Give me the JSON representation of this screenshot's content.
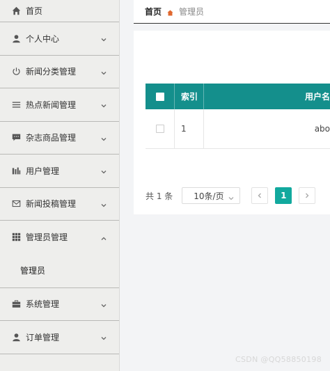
{
  "sidebar": {
    "items": [
      {
        "label": "首页",
        "icon": "home-icon"
      },
      {
        "label": "个人中心",
        "icon": "user-icon"
      },
      {
        "label": "新闻分类管理",
        "icon": "power-icon"
      },
      {
        "label": "热点新闻管理",
        "icon": "list-icon"
      },
      {
        "label": "杂志商品管理",
        "icon": "comment-icon"
      },
      {
        "label": "用户管理",
        "icon": "bars-icon"
      },
      {
        "label": "新闻投稿管理",
        "icon": "mail-icon"
      },
      {
        "label": "管理员管理",
        "icon": "grid-icon",
        "expanded": true,
        "children": [
          {
            "label": "管理员"
          }
        ]
      },
      {
        "label": "系统管理",
        "icon": "briefcase-icon"
      },
      {
        "label": "订单管理",
        "icon": "user-icon"
      }
    ]
  },
  "breadcrumb": {
    "home": "首页",
    "current": "管理员"
  },
  "table": {
    "headers": {
      "index": "索引",
      "username": "用户名"
    },
    "rows": [
      {
        "index": "1",
        "username": "abo"
      }
    ]
  },
  "pagination": {
    "total": "共 1 条",
    "page_size": "10条/页",
    "current_page": "1"
  },
  "watermark": "CSDN @QQ58850198",
  "colors": {
    "accent": "#148f8c",
    "page_active": "#12a99e",
    "sidebar_bg": "#eeeeec"
  }
}
